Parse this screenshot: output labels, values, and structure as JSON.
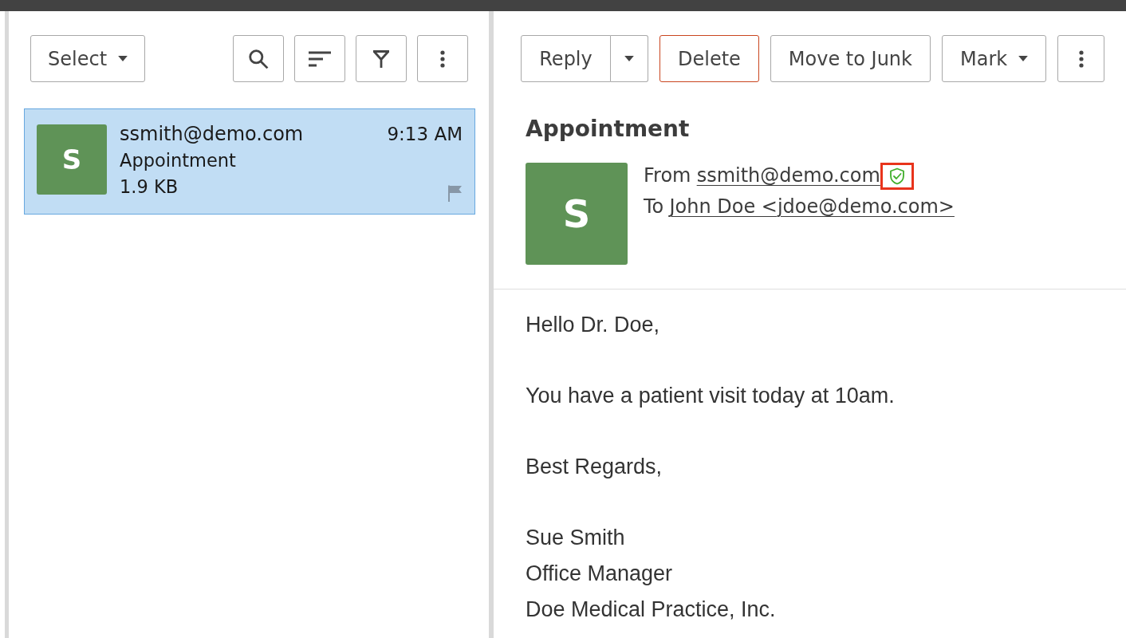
{
  "list_toolbar": {
    "select": {
      "label": "Select"
    },
    "tools": [
      {
        "kind": "search"
      },
      {
        "kind": "sort"
      },
      {
        "kind": "filter"
      },
      {
        "kind": "more"
      }
    ]
  },
  "messages": [
    {
      "sender": "ssmith@demo.com",
      "time": "9:13 AM",
      "subject": "Appointment",
      "size": "1.9 KB",
      "avatar": "S",
      "selected": true,
      "flagged": false
    }
  ],
  "reader_toolbar": [
    {
      "kind": "split",
      "label": "Reply"
    },
    {
      "kind": "danger",
      "label": "Delete"
    },
    {
      "kind": "plain",
      "label": "Move to Junk"
    },
    {
      "kind": "dropdown",
      "label": "Mark"
    },
    {
      "kind": "more"
    }
  ],
  "message": {
    "subject": "Appointment",
    "avatar": "S",
    "from": {
      "label": "From",
      "address": "ssmith@demo.com",
      "verified": true,
      "highlighted": true
    },
    "to": {
      "label": "To",
      "recipient": "John Doe <jdoe@demo.com>"
    }
  },
  "body": {
    "paragraphs": [
      "Hello Dr. Doe,",
      "You have a patient visit today at 10am.",
      "Best Regards,"
    ],
    "signature": [
      "Sue Smith",
      "Office Manager",
      "Doe Medical Practice, Inc."
    ]
  }
}
